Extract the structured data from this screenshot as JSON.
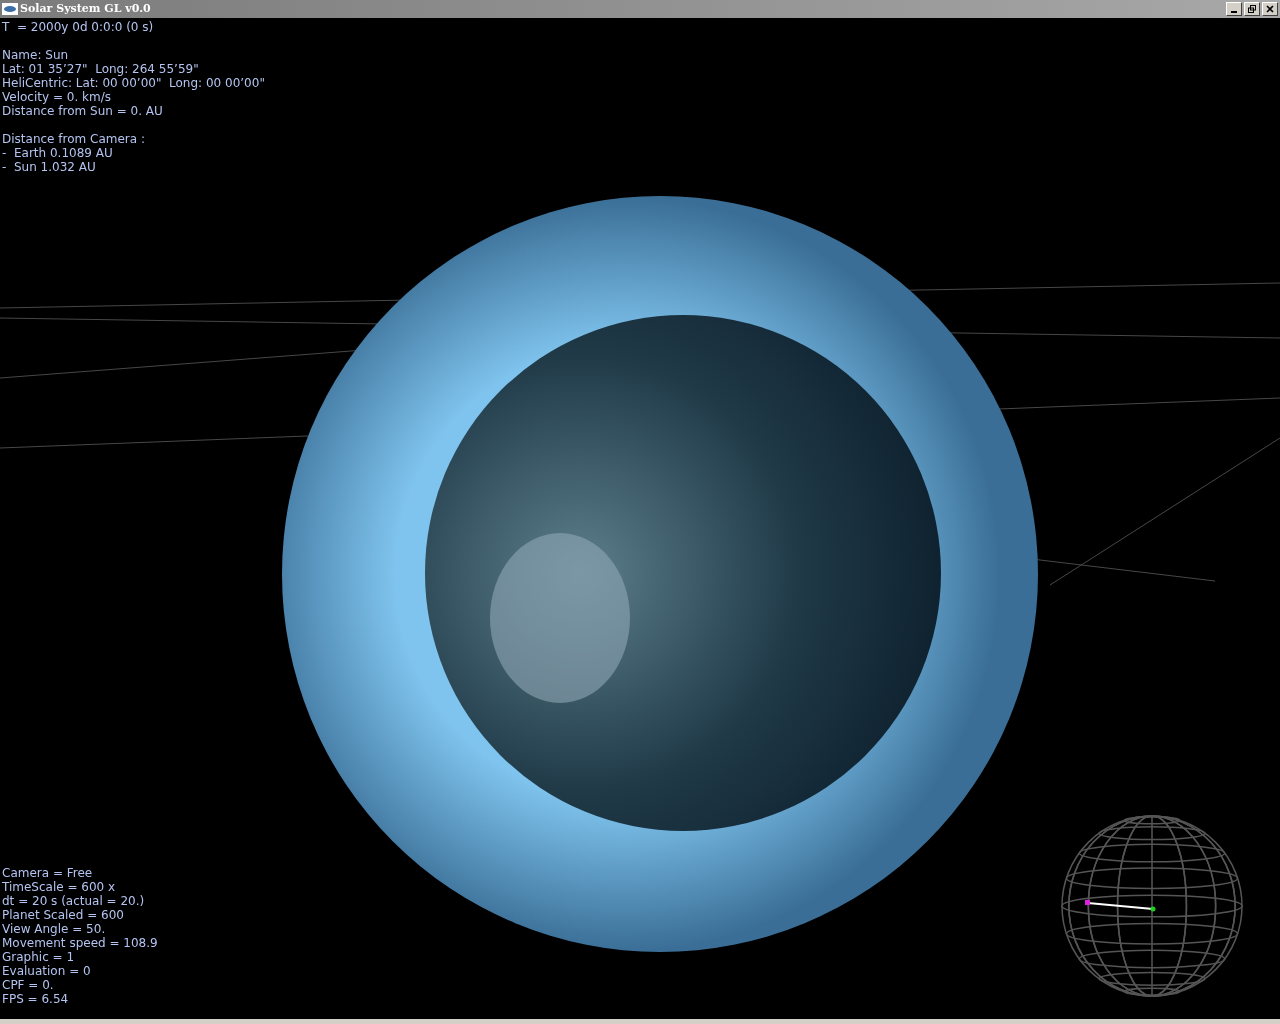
{
  "window": {
    "title": "Solar System GL v0.0"
  },
  "info_groups": [
    [
      "T  = 2000y 0d 0:0:0 (0 s)"
    ],
    [
      "Name: Sun",
      "Lat: 01 35’27\"  Long: 264 55’59\"",
      "HeliCentric: Lat: 00 00’00\"  Long: 00 00’00\"",
      "Velocity = 0. km/s",
      "Distance from Sun = 0. AU"
    ],
    [
      "Distance from Camera :",
      "-  Earth 0.1089 AU",
      "-  Sun 1.032 AU"
    ]
  ],
  "status_lines": [
    "Camera = Free",
    "TimeScale = 600 x",
    "dt = 20 s (actual = 20.)",
    "Planet Scaled = 600",
    "View Angle = 50.",
    "Movement speed = 108.9",
    "Graphic = 1",
    "Evaluation = 0",
    "CPF = 0.",
    "FPS = 6.54"
  ]
}
